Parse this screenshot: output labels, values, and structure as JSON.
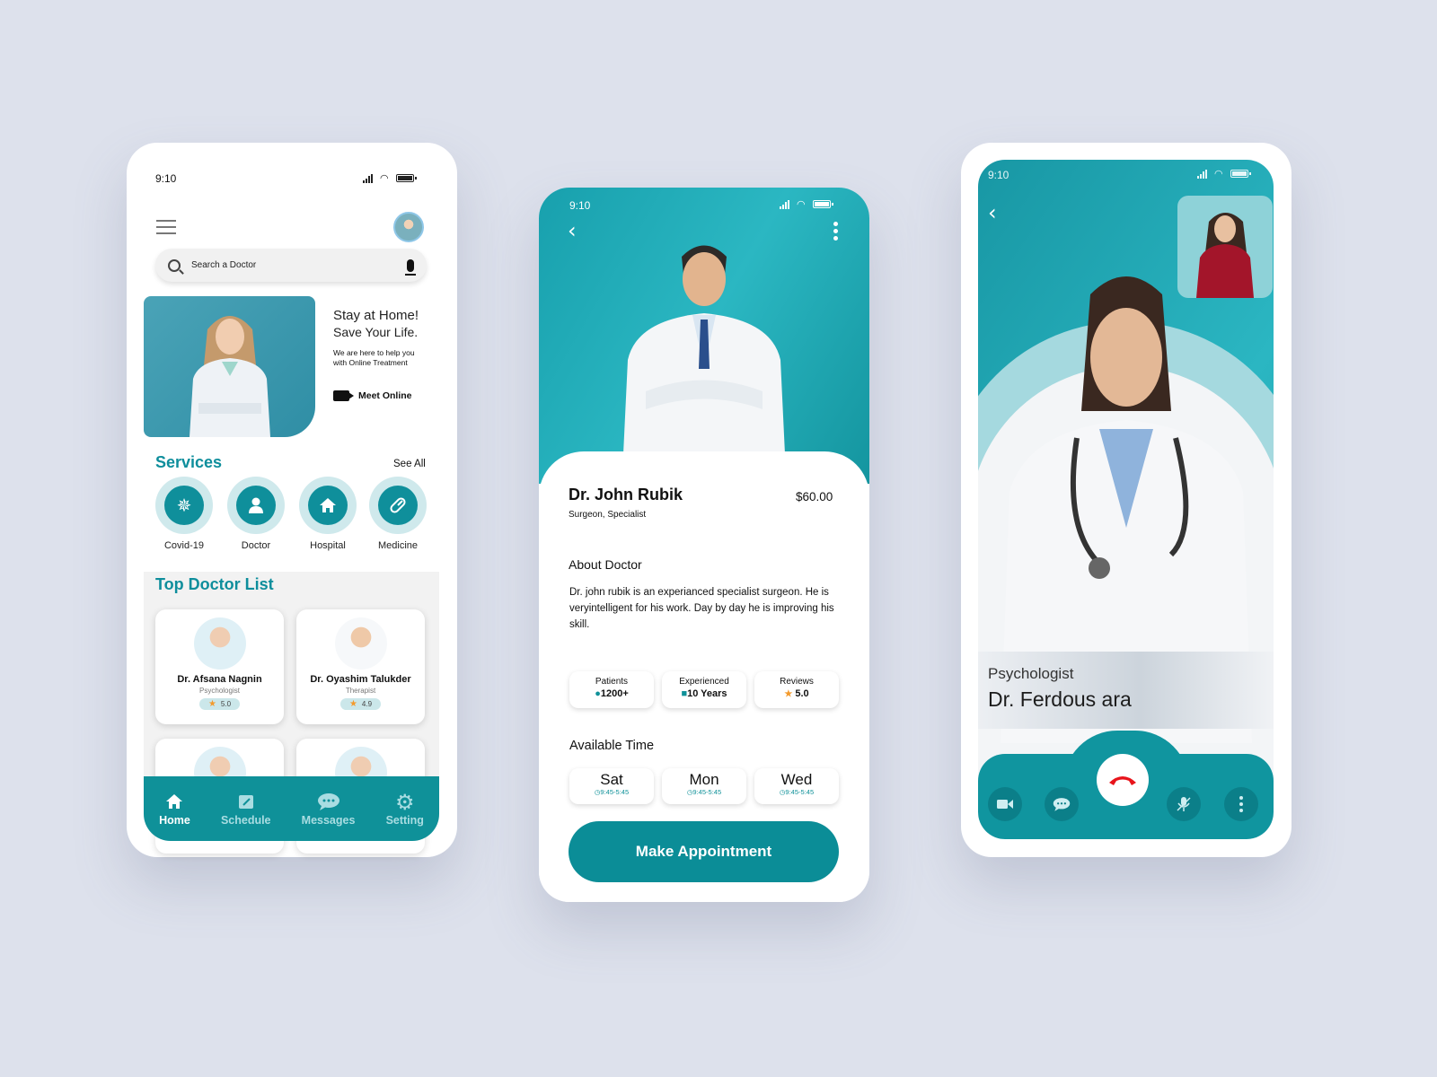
{
  "home": {
    "status": {
      "time": "9:10"
    },
    "search": {
      "placeholder": "Search a Doctor"
    },
    "hero": {
      "title_line1": "Stay at Home!",
      "title_line2": "Save Your Life.",
      "subtitle_line1": "We are here to help you",
      "subtitle_line2": "with Online Treatment",
      "cta": "Meet Online"
    },
    "services": {
      "title": "Services",
      "see_all": "See All",
      "items": [
        {
          "label": "Covid-19",
          "icon": "virus-icon"
        },
        {
          "label": "Doctor",
          "icon": "person-icon"
        },
        {
          "label": "Hospital",
          "icon": "home-icon"
        },
        {
          "label": "Medicine",
          "icon": "pill-icon"
        }
      ]
    },
    "top_doctors": {
      "title": "Top Doctor List",
      "items": [
        {
          "name": "Dr. Afsana Nagnin",
          "role": "Psychologist",
          "rating": "5.0"
        },
        {
          "name": "Dr. Oyashim Talukder",
          "role": "Therapist",
          "rating": "4.9"
        }
      ]
    },
    "nav": [
      {
        "label": "Home",
        "icon": "home-icon",
        "active": true
      },
      {
        "label": "Schedule",
        "icon": "schedule-icon",
        "active": false
      },
      {
        "label": "Messages",
        "icon": "messages-icon",
        "active": false
      },
      {
        "label": "Setting",
        "icon": "gear-icon",
        "active": false
      }
    ]
  },
  "detail": {
    "status": {
      "time": "9:10"
    },
    "doctor": {
      "name": "Dr. John Rubik",
      "specialty": "Surgeon, Specialist",
      "price": "$60.00"
    },
    "about": {
      "title": "About Doctor",
      "text": "Dr. john rubik is an experianced specialist surgeon. He is veryintelligent for his work. Day by day he is improving his skill."
    },
    "stats": [
      {
        "label": "Patients",
        "value": "1200+",
        "icon": "person-icon"
      },
      {
        "label": "Experienced",
        "value": "10 Years",
        "icon": "briefcase-icon"
      },
      {
        "label": "Reviews",
        "value": "5.0",
        "icon": "star-icon"
      }
    ],
    "available": {
      "title": "Available Time",
      "days": [
        {
          "day": "Sat",
          "time": "9:45-5:45"
        },
        {
          "day": "Mon",
          "time": "9:45-5:45"
        },
        {
          "day": "Wed",
          "time": "9:45-5:45"
        }
      ]
    },
    "cta": "Make Appointment"
  },
  "call": {
    "status": {
      "time": "9:10"
    },
    "doctor": {
      "role": "Psychologist",
      "name": "Dr. Ferdous ara"
    },
    "controls": [
      "video-icon",
      "chat-icon",
      "end-call-icon",
      "mic-off-icon",
      "more-icon"
    ],
    "colors": {
      "accent": "#0f9199",
      "end_call": "#e8141b"
    }
  }
}
